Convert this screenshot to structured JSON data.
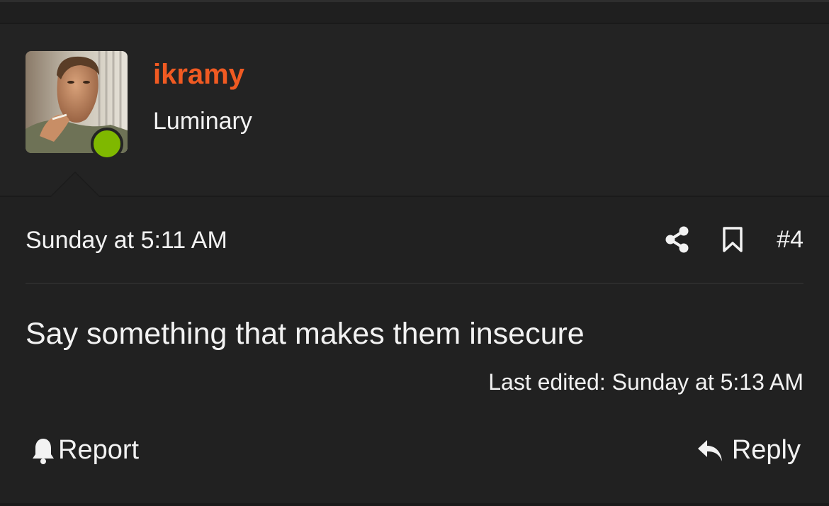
{
  "user": {
    "username": "ikramy",
    "title": "Luminary",
    "online": true
  },
  "post": {
    "timestamp": "Sunday at 5:11 AM",
    "number": "#4",
    "message": "Say something that makes them insecure",
    "last_edited": "Last edited: Sunday at 5:13 AM"
  },
  "actions": {
    "report_label": "Report",
    "reply_label": "Reply",
    "share_icon": "share-icon",
    "bookmark_icon": "bookmark-icon"
  },
  "colors": {
    "background": "#212121",
    "username": "#f05a22",
    "online": "#7fb800",
    "text": "#f2f2f2"
  }
}
